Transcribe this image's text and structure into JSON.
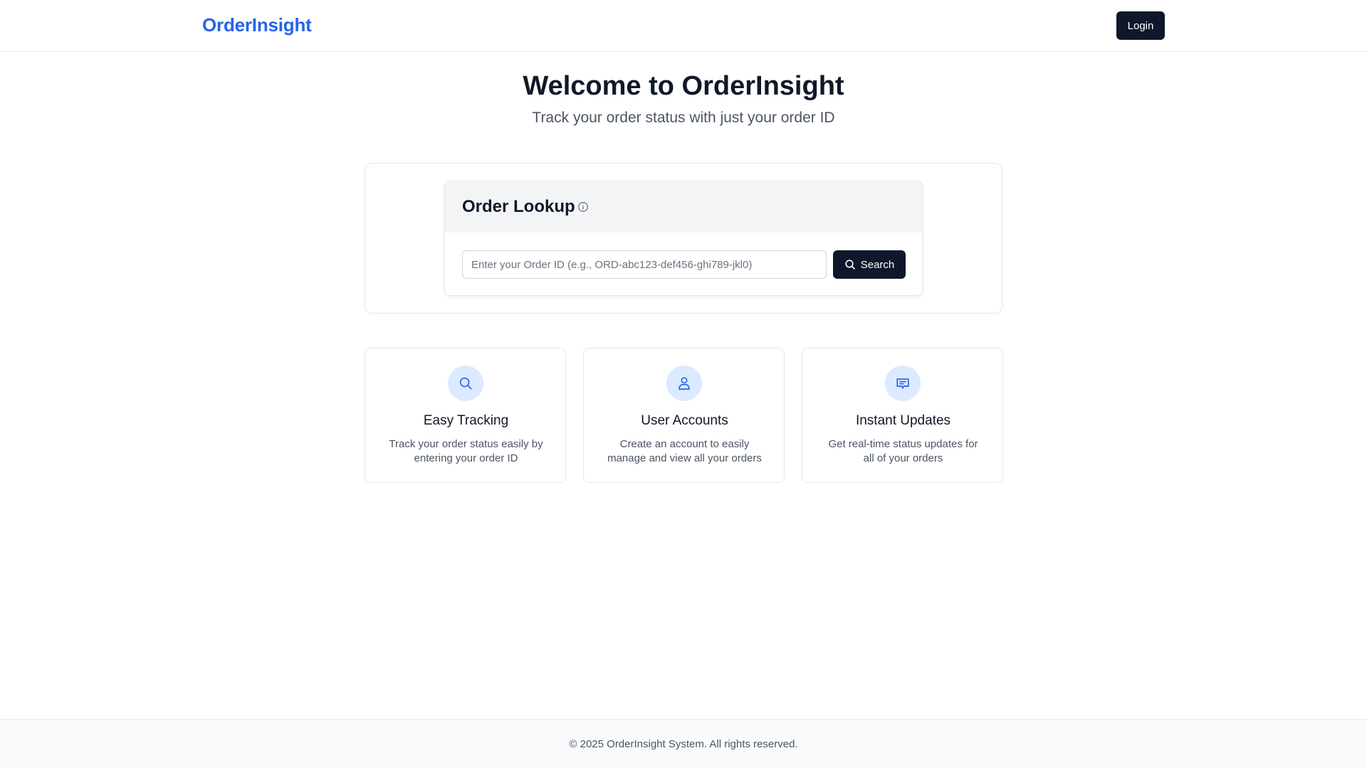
{
  "header": {
    "brand": "OrderInsight",
    "login_label": "Login"
  },
  "hero": {
    "title": "Welcome to OrderInsight",
    "subtitle": "Track your order status with just your order ID"
  },
  "lookup": {
    "title": "Order Lookup",
    "info_icon": "info-circle-icon",
    "input_value": "",
    "input_placeholder": "Enter your Order ID (e.g., ORD-abc123-def456-ghi789-jkl0)",
    "search_label": "Search",
    "search_icon": "search-icon"
  },
  "features": [
    {
      "icon": "search-icon",
      "title": "Easy Tracking",
      "description": "Track your order status easily by entering your order ID"
    },
    {
      "icon": "user-icon",
      "title": "User Accounts",
      "description": "Create an account to easily manage and view all your orders"
    },
    {
      "icon": "message-icon",
      "title": "Instant Updates",
      "description": "Get real-time status updates for all of your orders"
    }
  ],
  "footer": {
    "text": "© 2025 OrderInsight System. All rights reserved."
  },
  "colors": {
    "brand": "#2563eb",
    "primary_button": "#0f172a",
    "icon_bg": "#dbeafe",
    "border": "#e5e7eb"
  }
}
